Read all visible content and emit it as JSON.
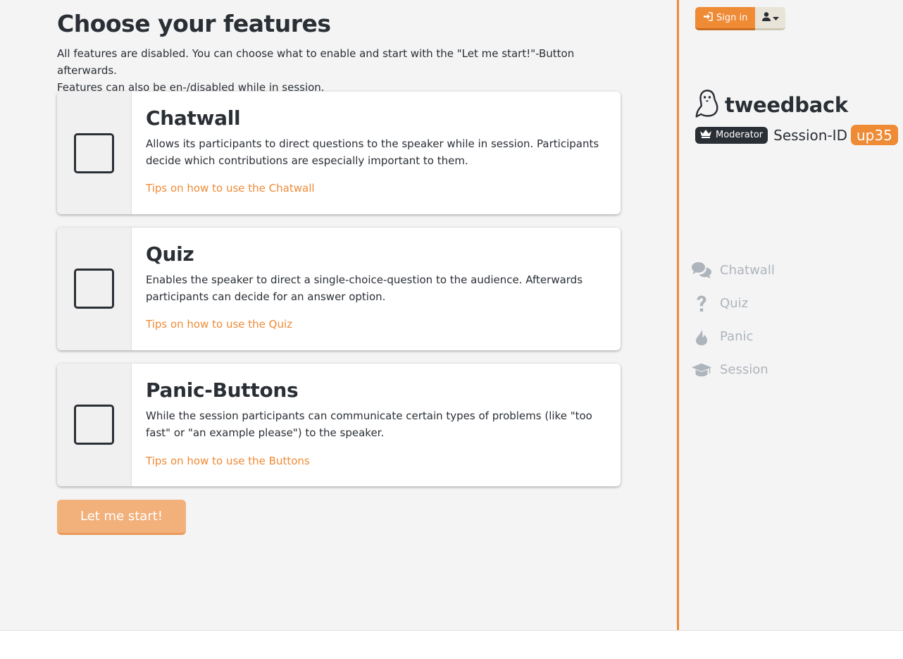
{
  "page": {
    "title": "Choose your features",
    "intro_line1": "All features are disabled. You can choose what to enable and start with the \"Let me start!\"-Button afterwards.",
    "intro_line2": "Features can also be en-/disabled while in session."
  },
  "features": [
    {
      "title": "Chatwall",
      "description": "Allows its participants to direct questions to the speaker while in session. Participants decide which contributions are especially important to them.",
      "link": "Tips on how to use the Chatwall",
      "enabled": false
    },
    {
      "title": "Quiz",
      "description": "Enables the speaker to direct a single-choice-question to the audience. Afterwards participants can decide for an answer option.",
      "link": "Tips on how to use the Quiz",
      "enabled": false
    },
    {
      "title": "Panic-Buttons",
      "description": "While the session participants can communicate certain types of problems (like \"too fast\" or \"an example please\") to the speaker.",
      "link": "Tips on how to use the Buttons",
      "enabled": false
    }
  ],
  "start_button": "Let me start!",
  "sidebar": {
    "signin_label": "Sign in",
    "brand": "tweedback",
    "role_badge": "Moderator",
    "session_label": "Session-ID",
    "session_id": "up35",
    "nav": [
      {
        "label": "Chatwall",
        "icon": "comments-icon"
      },
      {
        "label": "Quiz",
        "icon": "question-icon"
      },
      {
        "label": "Panic",
        "icon": "fire-icon"
      },
      {
        "label": "Session",
        "icon": "graduation-cap-icon"
      }
    ]
  },
  "colors": {
    "accent": "#ef8a35",
    "accent_light": "#f2b07a",
    "text_dark": "#2a2f35",
    "nav_muted": "#aeb4bb",
    "background": "#f4f4f4"
  }
}
